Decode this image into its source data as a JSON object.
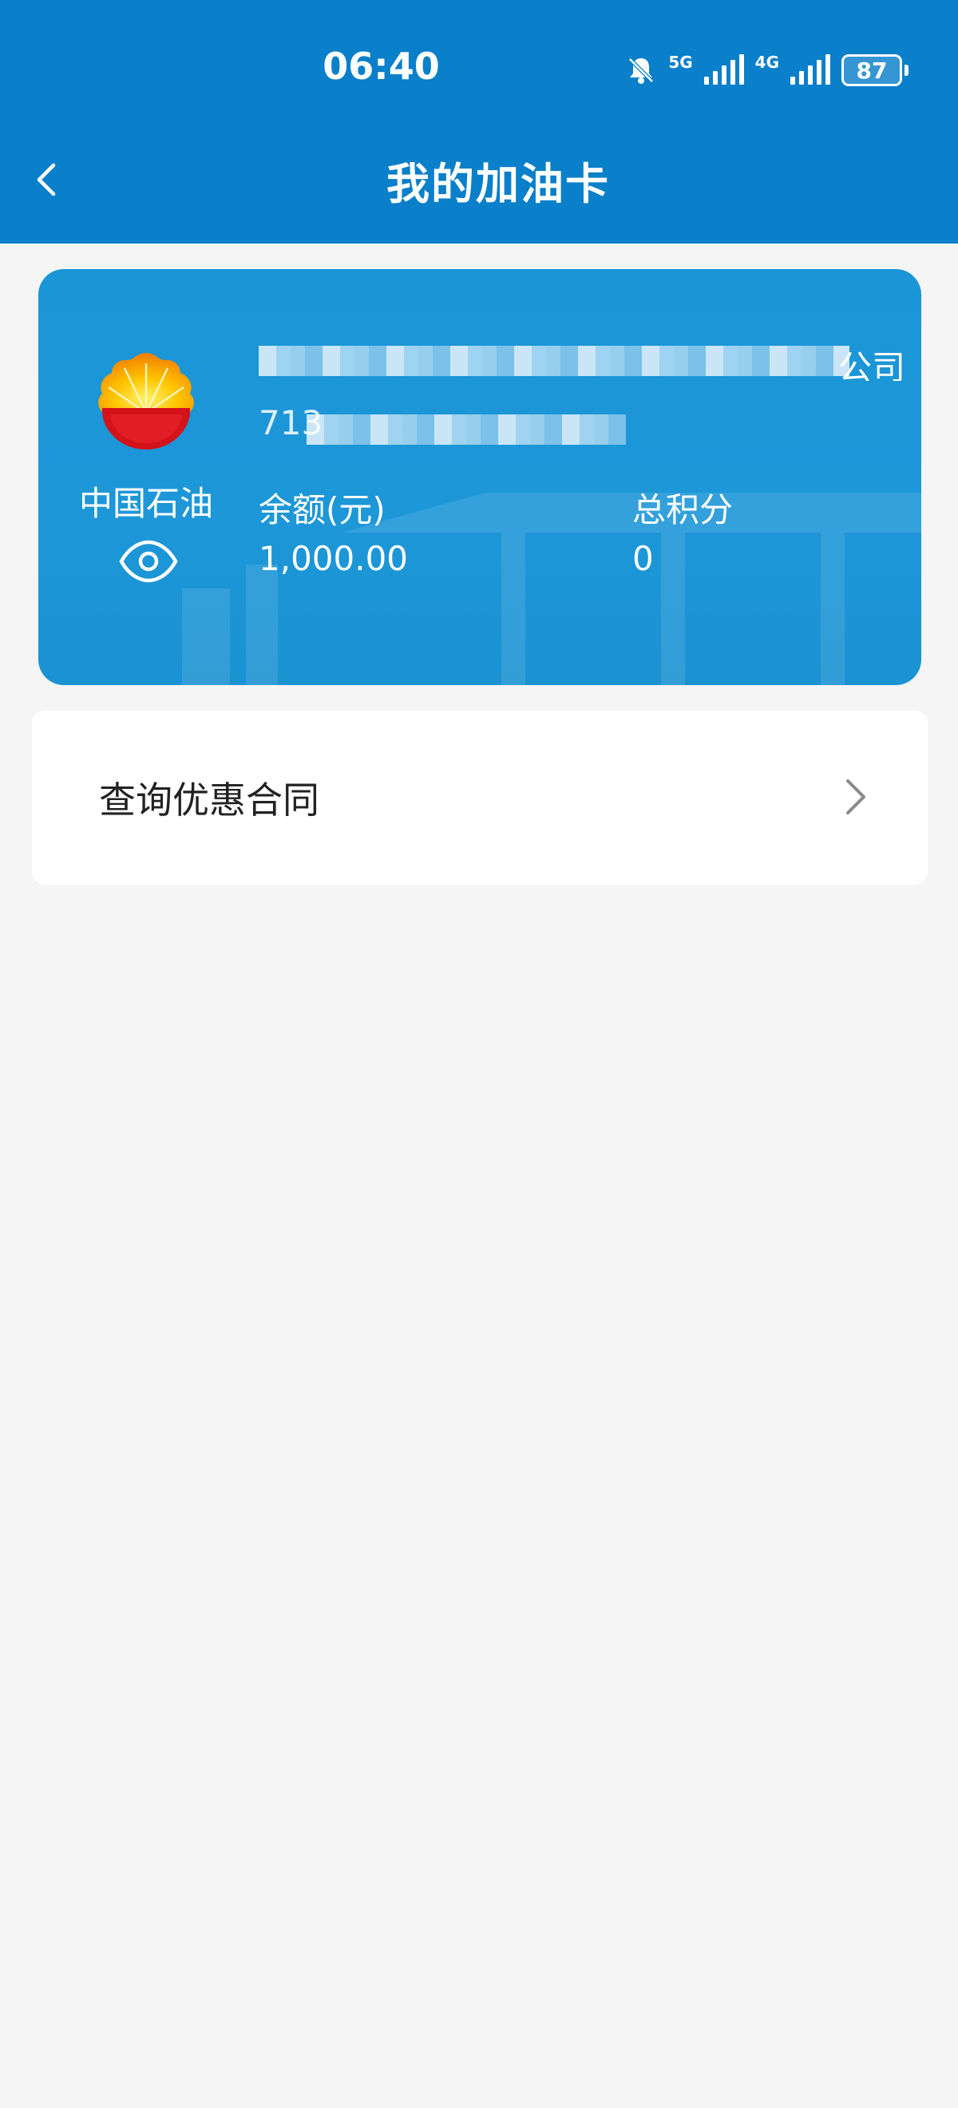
{
  "status_bar": {
    "time": "06:40",
    "icons": [
      "bell-mute-icon",
      "signal-icon",
      "signal-icon"
    ],
    "net1": "5G",
    "net2": "4G",
    "battery": "87"
  },
  "nav": {
    "title": "我的加油卡",
    "back_icon": "chevron-left-icon"
  },
  "card": {
    "brand": "中国石油",
    "company_suffix": "公司",
    "number_prefix": "713",
    "balance_label": "余额(元)",
    "balance_value": "1,000.00",
    "points_label": "总积分",
    "points_value": "0",
    "colors": {
      "card": "#1a95d6",
      "header": "#0a7fca"
    },
    "eye_icon": "eye-icon"
  },
  "menu": {
    "items": [
      {
        "label": "查询优惠合同",
        "icon": "chevron-right-icon"
      }
    ]
  }
}
